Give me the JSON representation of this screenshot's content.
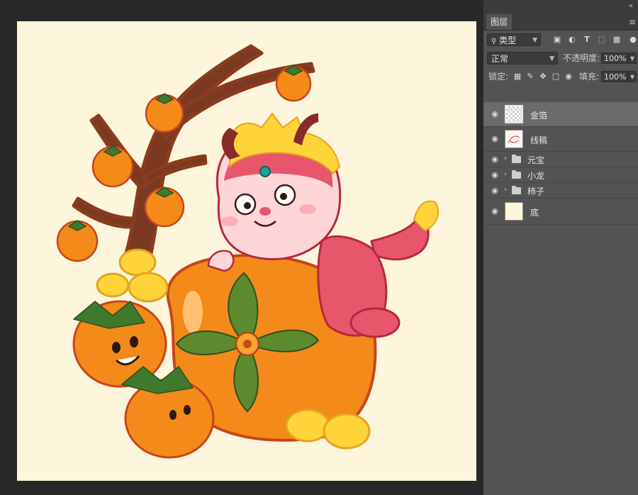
{
  "colors": {
    "canvas_bg": "#fdf6dc",
    "persimmon": "#f48a1a",
    "dragon_body": "#e8566b",
    "gold": "#ffd43a",
    "branch": "#7a3a22",
    "leaf": "#5c8a2e"
  },
  "panel": {
    "tab_label": "图层",
    "collapse_icon": "double-chevron-icon",
    "menu_icon": "hamburger-icon"
  },
  "filter": {
    "kind_label": "类型",
    "icons": [
      "image-filter-icon",
      "adjustment-filter-icon",
      "type-filter-icon",
      "shape-filter-icon",
      "smart-object-filter-icon"
    ]
  },
  "blend": {
    "mode": "正常",
    "opacity_label": "不透明度:",
    "opacity_value": "100%"
  },
  "lock": {
    "label": "锁定:",
    "fill_label": "填充:",
    "fill_value": "100%"
  },
  "layers": [
    {
      "name": "金箔",
      "type": "layer",
      "thumb": "checker",
      "selected": true,
      "visible": true
    },
    {
      "name": "线稿",
      "type": "layer",
      "thumb": "lineart",
      "selected": false,
      "visible": true
    },
    {
      "name": "元宝",
      "type": "group",
      "thumb": "",
      "selected": false,
      "visible": true
    },
    {
      "name": "小龙",
      "type": "group",
      "thumb": "",
      "selected": false,
      "visible": true
    },
    {
      "name": "柿子",
      "type": "group",
      "thumb": "",
      "selected": false,
      "visible": true
    },
    {
      "name": "底",
      "type": "layer",
      "thumb": "solid",
      "selected": false,
      "visible": true
    }
  ]
}
